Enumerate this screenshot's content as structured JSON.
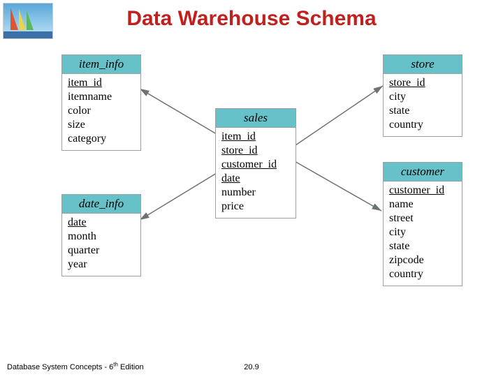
{
  "title": "Data Warehouse Schema",
  "footer": {
    "left_a": "Database System Concepts - 6",
    "left_sup": "th",
    "left_b": " Edition",
    "page": "20.9"
  },
  "tables": {
    "item_info": {
      "name": "item_info",
      "key": "item_id",
      "cols": [
        "itemname",
        "color",
        "size",
        "category"
      ]
    },
    "date_info": {
      "name": "date_info",
      "key": "date",
      "cols": [
        "month",
        "quarter",
        "year"
      ]
    },
    "sales": {
      "name": "sales",
      "cols": [
        "item_id",
        "store_id",
        "customer_id",
        "date",
        "number",
        "price"
      ],
      "underline_to": 4
    },
    "store": {
      "name": "store",
      "key": "store_id",
      "cols": [
        "city",
        "state",
        "country"
      ]
    },
    "customer": {
      "name": "customer",
      "key": "customer_id",
      "cols": [
        "name",
        "street",
        "city",
        "state",
        "zipcode",
        "country"
      ]
    }
  }
}
